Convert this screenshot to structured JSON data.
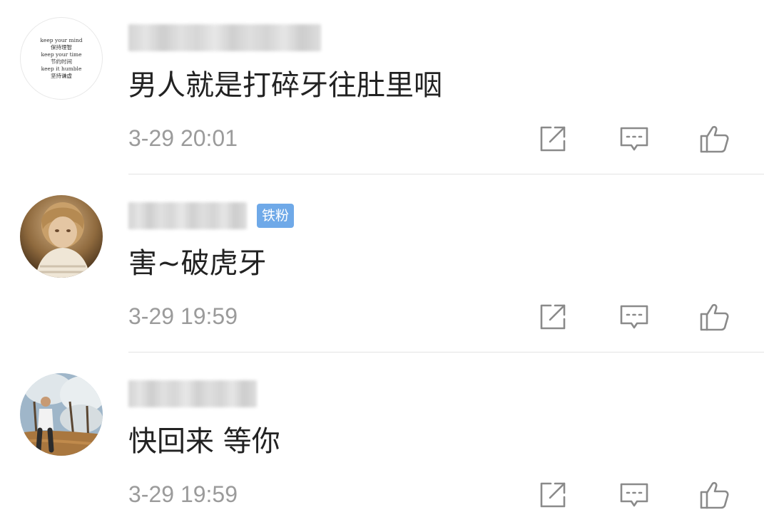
{
  "comments": [
    {
      "avatar": {
        "type": "text",
        "lines": [
          "keep your mind",
          "保持理智",
          "keep your time",
          "节约时间",
          "keep it humble",
          "坚持谦虚"
        ]
      },
      "badge": "",
      "text": "男人就是打碎牙往肚里咽",
      "time": "3-29 20:01"
    },
    {
      "avatar": {
        "type": "photo-child"
      },
      "badge": "铁粉",
      "text": "害~破虎牙",
      "time": "3-29 19:59"
    },
    {
      "avatar": {
        "type": "photo-man-orchard"
      },
      "badge": "",
      "text": "快回来 等你",
      "time": "3-29 19:59"
    }
  ],
  "icons": {
    "share": "share-icon",
    "reply": "comment-icon",
    "like": "thumbs-up-icon"
  },
  "colors": {
    "text": "#222222",
    "meta": "#9b9b9b",
    "icon": "#8a8a8a",
    "badge": "#6fa9e8",
    "divider": "#e3e3e3"
  }
}
